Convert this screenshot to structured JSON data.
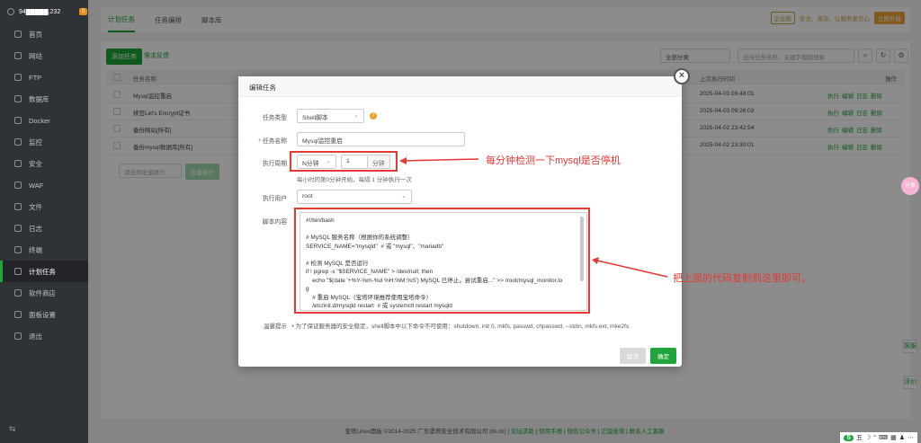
{
  "sidebar": {
    "ip": "94█████.232",
    "badge": "0",
    "items": [
      {
        "label": "首页",
        "icon": "home-icon"
      },
      {
        "label": "网站",
        "icon": "globe-icon"
      },
      {
        "label": "FTP",
        "icon": "ftp-icon"
      },
      {
        "label": "数据库",
        "icon": "database-icon"
      },
      {
        "label": "Docker",
        "icon": "docker-icon"
      },
      {
        "label": "监控",
        "icon": "monitor-icon"
      },
      {
        "label": "安全",
        "icon": "shield-icon"
      },
      {
        "label": "WAF",
        "icon": "waf-icon"
      },
      {
        "label": "文件",
        "icon": "folder-icon"
      },
      {
        "label": "日志",
        "icon": "log-icon"
      },
      {
        "label": "终端",
        "icon": "terminal-icon"
      },
      {
        "label": "计划任务",
        "icon": "calendar-icon",
        "active": true
      },
      {
        "label": "软件商店",
        "icon": "store-icon"
      },
      {
        "label": "面板设置",
        "icon": "settings-icon"
      },
      {
        "label": "退出",
        "icon": "logout-icon"
      }
    ],
    "collapse": "⇆"
  },
  "header": {
    "tabs": [
      "计划任务",
      "任务编排",
      "脚本库"
    ],
    "version_tag": "企业版",
    "promo": "安全、高效、让服务更安心",
    "upgrade": "立即升级"
  },
  "toolbar": {
    "add": "添加任务",
    "feedback": "需求反馈",
    "filter": "全部分类",
    "search_placeholder": "支持任务名称、关键字模糊搜索"
  },
  "table": {
    "headers": {
      "name": "任务名称",
      "last_run": "上次执行时间",
      "ops": "操作"
    },
    "rows": [
      {
        "name": "Mysql监控重启",
        "last_run": "2025-04-03 09:48:01"
      },
      {
        "name": "续签Let's Encrypt证书",
        "last_run": "2025-04-03 09:26:03"
      },
      {
        "name": "备份网站[所有]",
        "last_run": "2025-04-02 23:42:54"
      },
      {
        "name": "备份mysql数据库[所有]",
        "last_run": "2025-04-02 23:30:01"
      }
    ],
    "ops": [
      "执行",
      "编辑",
      "日志",
      "删除"
    ],
    "batch_placeholder": "请选择批量操作",
    "batch_btn": "批量操作"
  },
  "modal": {
    "title": "编辑任务",
    "task_type_label": "任务类型",
    "task_type": "Shell脚本",
    "task_name_label": "任务名称",
    "task_name": "Mysql监控重启",
    "cycle_label": "执行周期",
    "cycle_type": "N分钟",
    "cycle_value": "1",
    "cycle_unit": "分钟",
    "cycle_hint": "每小时的第0分钟开始，每隔 1 分钟执行一次",
    "user_label": "执行用户",
    "user": "root",
    "script_label": "脚本内容",
    "script_lines": [
      "#!/bin/bash",
      "",
      "# MySQL 服务名称（根据你的系统调整）",
      "SERVICE_NAME=\"mysqld\"  # 或 \"mysql\"、\"mariadb\"",
      "",
      "# 检测 MySQL 是否运行",
      "if ! pgrep -x \"$SERVICE_NAME\" > /dev/null; then",
      "    echo \"$(date '+%Y-%m-%d %H:%M:%S') MySQL 已停止，尝试重启...\" >> /root/mysql_monitor.lo",
      "g",
      "    # 重启 MySQL（宝塔环境推荐使用宝塔命令）",
      "    /etc/init.d/mysqld restart  # 或 systemctl restart mysqld"
    ],
    "tip_label": "温馨提示",
    "tip": "• 为了保证服务器的安全稳定，shell脚本中以下命令不可使用：shutdown, init 0, mkfs, passwd, chpasswd, --stdin, mkfs.ext, mke2fs",
    "cancel": "取消",
    "confirm": "确定",
    "close": "×"
  },
  "annotations": {
    "a1": "每分钟检测一下mysql是否停机",
    "a2": "把上面的代码复制到这里即可。"
  },
  "footer": {
    "copyright": "宝塔Linux面板 ©2014-2025 广东堡塔安全技术有限公司 (bt.cn)",
    "links": [
      "论坛求助",
      "使用手册",
      "微信公众号",
      "正版查询",
      "联系人工客服"
    ]
  },
  "floats": {
    "service": "客服",
    "review": "评价",
    "pink": "分享"
  },
  "tray": [
    "S",
    "五",
    "☽",
    "°",
    "⌨",
    "▦",
    "♟",
    "⋯"
  ],
  "colors": {
    "accent": "#20a53a",
    "annotation": "#e53935"
  }
}
